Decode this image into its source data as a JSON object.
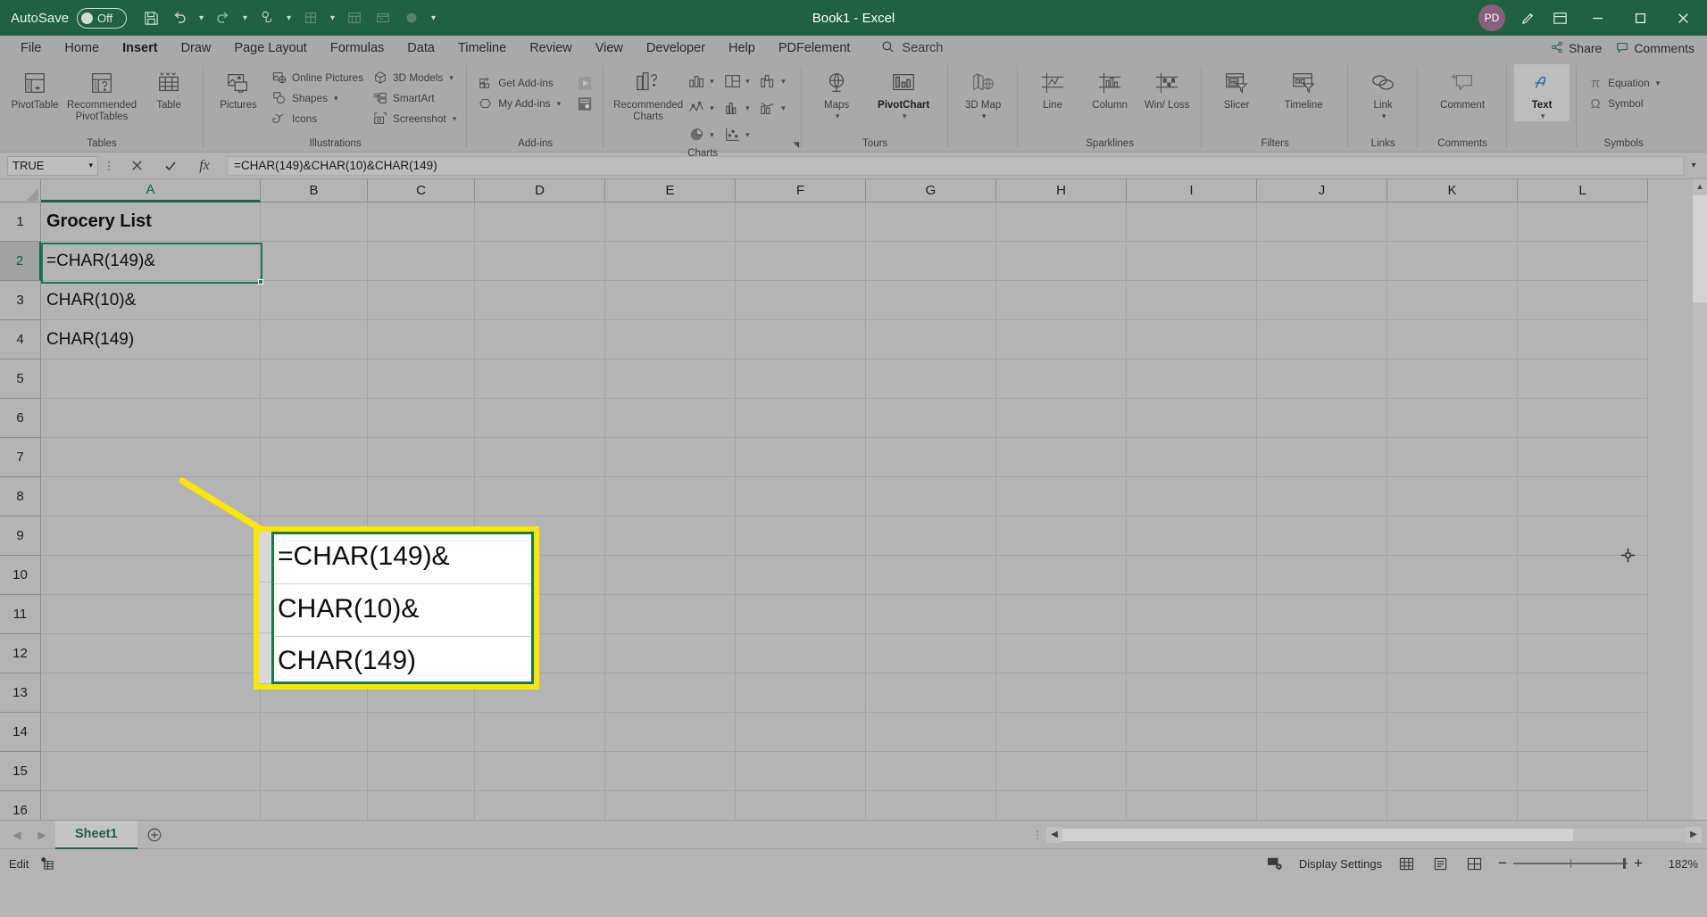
{
  "titlebar": {
    "autosave_label": "AutoSave",
    "autosave_state": "Off",
    "document_title": "Book1  -  Excel",
    "qat_icons": [
      "save-icon",
      "undo-icon",
      "redo-icon",
      "touch-mode-icon",
      "new-sheet-icon",
      "table-icon",
      "form-icon",
      "record-icon",
      "more-icon"
    ],
    "account_initials": "PD",
    "window_buttons": [
      "minimize",
      "restore",
      "close"
    ]
  },
  "tabs": [
    {
      "label": "File",
      "active": false
    },
    {
      "label": "Home",
      "active": false
    },
    {
      "label": "Insert",
      "active": true
    },
    {
      "label": "Draw",
      "active": false
    },
    {
      "label": "Page Layout",
      "active": false
    },
    {
      "label": "Formulas",
      "active": false
    },
    {
      "label": "Data",
      "active": false
    },
    {
      "label": "Timeline",
      "active": false
    },
    {
      "label": "Review",
      "active": false
    },
    {
      "label": "View",
      "active": false
    },
    {
      "label": "Developer",
      "active": false
    },
    {
      "label": "Help",
      "active": false
    },
    {
      "label": "PDFelement",
      "active": false
    }
  ],
  "search": {
    "placeholder": "Search",
    "label": "Search"
  },
  "tabbar_right": [
    {
      "label": "Share",
      "icon": "share-icon"
    },
    {
      "label": "Comments",
      "icon": "comment-icon"
    }
  ],
  "ribbon": {
    "groups": [
      {
        "name": "Tables",
        "label": "Tables",
        "buttons": [
          {
            "label": "PivotTable",
            "icon": "pivot-table-icon"
          },
          {
            "label": "Recommended PivotTables",
            "icon": "recommended-pivot-icon"
          },
          {
            "label": "Table",
            "icon": "table-icon"
          }
        ]
      },
      {
        "name": "Illustrations",
        "label": "Illustrations",
        "buttons": [
          {
            "label": "Pictures",
            "icon": "pictures-icon"
          }
        ],
        "small_col_1": [
          {
            "label": "Online Pictures",
            "icon": "online-pictures-icon",
            "caret": false
          },
          {
            "label": "Shapes",
            "icon": "shapes-icon",
            "caret": true
          },
          {
            "label": "Icons",
            "icon": "icons-icon",
            "caret": false
          }
        ],
        "small_col_2": [
          {
            "label": "3D Models",
            "icon": "3d-models-icon",
            "caret": true
          },
          {
            "label": "SmartArt",
            "icon": "smartart-icon",
            "caret": false
          },
          {
            "label": "Screenshot",
            "icon": "screenshot-icon",
            "caret": true
          }
        ]
      },
      {
        "name": "Add-ins",
        "label": "Add-ins",
        "small_col_1": [
          {
            "label": "Get Add-ins",
            "icon": "get-addins-icon",
            "caret": false
          },
          {
            "label": "My Add-ins",
            "icon": "my-addins-icon",
            "caret": true
          }
        ],
        "extra_icons": [
          "store-video-icon",
          "people-graph-icon"
        ]
      },
      {
        "name": "Charts",
        "label": "Charts",
        "buttons": [
          {
            "label": "Recommended Charts",
            "icon": "recommended-charts-icon"
          }
        ],
        "chart_icons": [
          "column-chart-icon",
          "hierarchy-chart-icon",
          "waterfall-chart-icon",
          "line-chart-icon",
          "statistic-chart-icon",
          "combo-chart-icon",
          "pie-chart-icon",
          "scatter-chart-icon"
        ],
        "has_dialog_launcher": true
      },
      {
        "name": "Tours",
        "label": "Tours",
        "buttons": [
          {
            "label": "Maps",
            "icon": "maps-icon",
            "caret": true
          },
          {
            "label": "PivotChart",
            "icon": "pivotchart-icon",
            "caret": true,
            "dark": true
          },
          {
            "label": "3D Map",
            "icon": "3d-map-icon",
            "caret": true
          }
        ]
      },
      {
        "name": "Sparklines",
        "label": "Sparklines",
        "buttons": [
          {
            "label": "Line",
            "icon": "sparkline-line-icon"
          },
          {
            "label": "Column",
            "icon": "sparkline-column-icon"
          },
          {
            "label": "Win/ Loss",
            "icon": "sparkline-winloss-icon"
          }
        ]
      },
      {
        "name": "Filters",
        "label": "Filters",
        "buttons": [
          {
            "label": "Slicer",
            "icon": "slicer-icon"
          },
          {
            "label": "Timeline",
            "icon": "timeline-icon"
          }
        ]
      },
      {
        "name": "Links",
        "label": "Links",
        "buttons": [
          {
            "label": "Link",
            "icon": "link-icon",
            "caret": true
          }
        ]
      },
      {
        "name": "Comments",
        "label": "Comments",
        "buttons": [
          {
            "label": "Comment",
            "icon": "comment-add-icon"
          }
        ]
      },
      {
        "name": "Text",
        "label": "",
        "buttons": [
          {
            "label": "Text",
            "icon": "text-box-icon",
            "caret": true,
            "dark": true
          }
        ]
      },
      {
        "name": "Symbols",
        "label": "Symbols",
        "small_col_1": [
          {
            "label": "Equation",
            "icon": "equation-icon",
            "caret": true
          },
          {
            "label": "Symbol",
            "icon": "symbol-icon",
            "caret": false
          }
        ]
      }
    ]
  },
  "formulabar": {
    "namebox_value": "TRUE",
    "cancel_label": "✕",
    "enter_label": "✓",
    "fx_label": "fx",
    "formula_value": "=CHAR(149)&CHAR(10)&CHAR(149)"
  },
  "grid": {
    "columns": [
      "A",
      "B",
      "C",
      "D",
      "E",
      "F",
      "G",
      "H",
      "I",
      "J",
      "K",
      "L"
    ],
    "selected_column": "A",
    "rows": [
      "1",
      "2",
      "3",
      "4",
      "5",
      "6",
      "7",
      "8",
      "9",
      "10",
      "11",
      "12",
      "13",
      "14",
      "15",
      "16"
    ],
    "selected_row": "2",
    "cells": {
      "A1": "Grocery List",
      "A2": "=CHAR(149)&",
      "A3": "CHAR(10)&",
      "A4": "CHAR(149)"
    },
    "active_cell": "A2"
  },
  "callout": {
    "lines": [
      "=CHAR(149)&",
      "CHAR(10)&",
      "CHAR(149)"
    ],
    "border_color": "#ffe600",
    "selection_color": "#1a7a4c"
  },
  "sheetbar": {
    "tabs": [
      {
        "label": "Sheet1",
        "active": true
      }
    ],
    "add_sheet_label": "+",
    "nav_prev": "◀",
    "nav_next": "▶"
  },
  "statusbar": {
    "mode": "Edit",
    "macro_icon": "record-macro-icon",
    "display_settings": "Display Settings",
    "view_buttons": [
      "normal-view-icon",
      "page-layout-view-icon",
      "page-break-view-icon"
    ],
    "zoom_out": "−",
    "zoom_in": "+",
    "zoom_level": "182%"
  },
  "colors": {
    "brand_green": "#1f6141",
    "selection_green": "#1a7a4c",
    "highlight_yellow": "#ffe600",
    "ribbon_gray": "#a9a9a9",
    "grid_gray": "#b4b4b4"
  }
}
